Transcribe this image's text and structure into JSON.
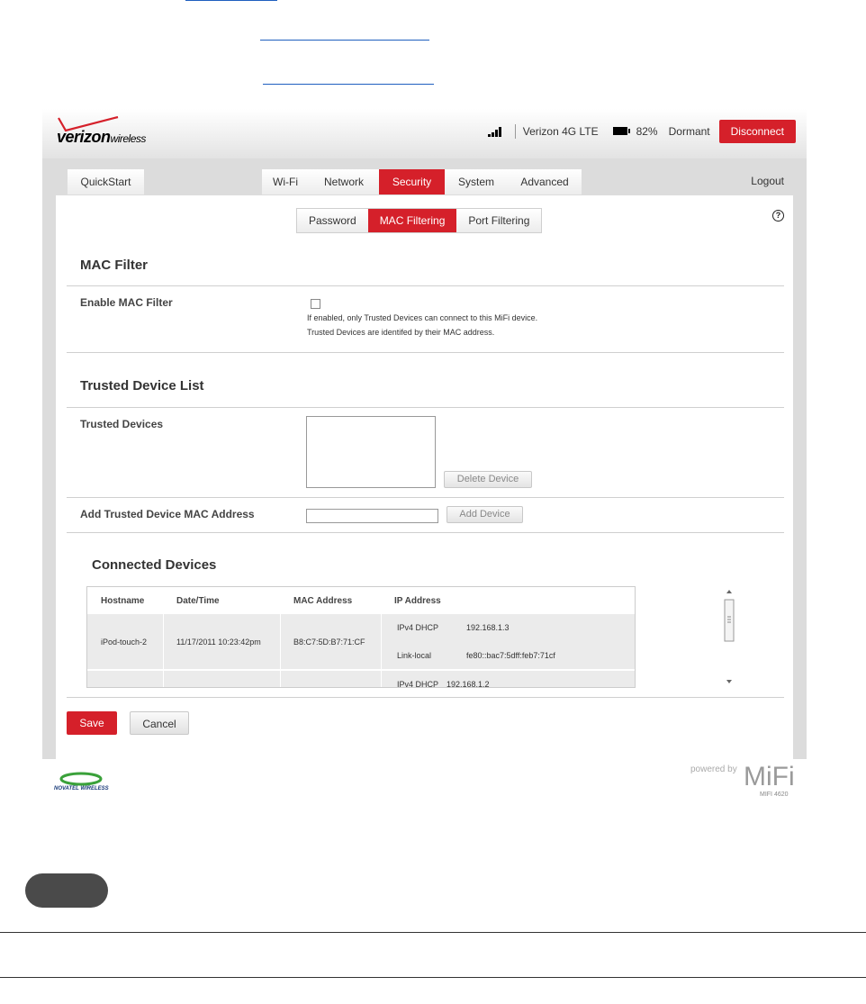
{
  "app": {
    "brand": {
      "name": "verizon",
      "suffix": "wireless"
    },
    "status": {
      "network": "Verizon 4G LTE",
      "battery": "82%",
      "connection": "Dormant",
      "signal_bars": 4,
      "disconnect_label": "Disconnect"
    },
    "nav": {
      "quickstart": "QuickStart",
      "tabs": [
        "Wi-Fi",
        "Network",
        "Security",
        "System",
        "Advanced"
      ],
      "active_tab": "Security",
      "logout": "Logout"
    },
    "subtabs": {
      "items": [
        "Password",
        "MAC Filtering",
        "Port Filtering"
      ],
      "active": "MAC Filtering"
    },
    "help_label": "?",
    "mac_filter": {
      "heading": "MAC Filter",
      "enable_label": "Enable MAC Filter",
      "enabled": false,
      "help_line1": "If enabled, only Trusted Devices can connect to this MiFi device.",
      "help_line2": "Trusted Devices are identifed by their MAC address."
    },
    "trusted": {
      "heading": "Trusted Device List",
      "devices_label": "Trusted Devices",
      "delete_label": "Delete Device",
      "add_label": "Add Trusted Device MAC Address",
      "add_value": "",
      "add_button": "Add Device"
    },
    "connected": {
      "heading": "Connected Devices",
      "columns": [
        "Hostname",
        "Date/Time",
        "MAC Address",
        "IP Address"
      ],
      "rows": [
        {
          "hostname": "iPod-touch-2",
          "datetime": "11/17/2011 10:23:42pm",
          "mac": "B8:C7:5D:B7:71:CF",
          "ip": [
            {
              "type": "IPv4 DHCP",
              "value": "192.168.1.3"
            },
            {
              "type": "Link-local",
              "value": "fe80::bac7:5dff:feb7:71cf"
            }
          ]
        },
        {
          "hostname": "",
          "datetime": "",
          "mac": "",
          "ip": [
            {
              "type": "IPv4 DHCP",
              "value": "192.168.1.2"
            }
          ]
        }
      ]
    },
    "actions": {
      "save": "Save",
      "cancel": "Cancel"
    },
    "footer": {
      "left_logo": "NOVATEL WIRELESS",
      "powered_by": "powered by",
      "product": "MiFi",
      "model": "MIFI 4620"
    }
  }
}
